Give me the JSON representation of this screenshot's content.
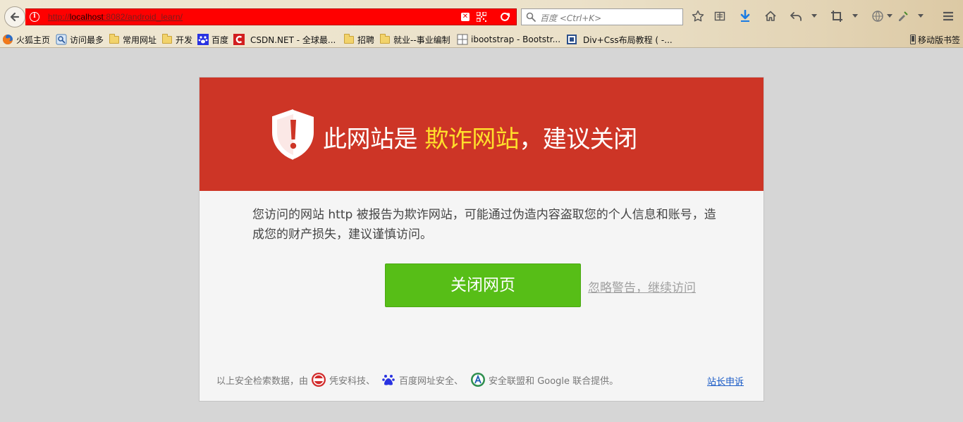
{
  "browser": {
    "url": {
      "prefix": "http://",
      "host": "localhost",
      "path": ":8082/android_learn/"
    },
    "search": {
      "placeholder": "百度 <Ctrl+K>"
    },
    "bookmarks": [
      {
        "label": "火狐主页",
        "icon": "firefox-icon"
      },
      {
        "label": "访问最多",
        "icon": "most-visited-icon"
      },
      {
        "label": "常用网址",
        "icon": "folder-icon"
      },
      {
        "label": "开发",
        "icon": "folder-icon"
      },
      {
        "label": "百度",
        "icon": "baidu-paw-icon"
      },
      {
        "label": "CSDN.NET - 全球最...",
        "icon": "csdn-icon"
      },
      {
        "label": "招聘",
        "icon": "folder-icon"
      },
      {
        "label": "就业--事业编制",
        "icon": "folder-icon"
      },
      {
        "label": "ibootstrap - Bootstr...",
        "icon": "grid-icon"
      },
      {
        "label": "Div+Css布局教程 ( -...",
        "icon": "page-icon"
      }
    ],
    "mobile_bookmarks": "移动版书签"
  },
  "warning": {
    "title_prefix": "此网站是 ",
    "title_danger": "欺诈网站",
    "title_suffix": "，建议关闭",
    "description": "您访问的网站 http  被报告为欺诈网站，可能通过伪造内容盗取您的个人信息和账号，造成您的财产损失，建议谨慎访问。",
    "close_button": "关闭网页",
    "ignore_link": "忽略警告，继续访问",
    "footer": {
      "text_1": "以上安全检索数据，由",
      "provider_1": "凭安科技、",
      "provider_2": "百度网址安全、",
      "provider_3": "安全联盟",
      "text_2": " 和 Google 联合提供。"
    },
    "report_link": "站长申诉"
  },
  "colors": {
    "banner": "#cd3526",
    "danger_text": "#ffde2b",
    "close_button": "#57be17",
    "url_bar": "#ff0000",
    "link": "#1a5bc7"
  }
}
